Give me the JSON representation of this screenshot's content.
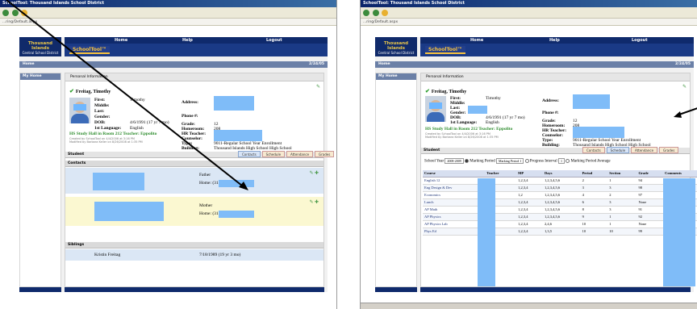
{
  "left": {
    "title_bar": "SchoolTool: Thousand Islands School District",
    "address": "...ring/Default.aspx",
    "logo": {
      "line1": "Thousand Islands",
      "line2": "Central School District"
    },
    "nav": {
      "home": "Home",
      "help": "Help",
      "logout": "Logout"
    },
    "brand": "SchoolTool™",
    "home_bar": "Home",
    "date": "2/24/05",
    "sidebar_heading": "My Home",
    "tab": "Personal Information",
    "student_name": "Freitag, Timothy",
    "labels": {
      "first": "First:",
      "middle": "Middle:",
      "last": "Last:",
      "gender": "Gender:",
      "dob": "DOB:",
      "first_language": "1st Language:",
      "address": "Address:",
      "phone": "Phone #:",
      "grade": "Grade:",
      "homeroom": "Homeroom:",
      "hr_teacher": "HR Teacher:",
      "counselor": "Counselor:",
      "type": "Type:",
      "building": "Building:"
    },
    "values": {
      "first": "Timothy",
      "dob": "4/6/1991 (17 yr 7 mo)",
      "first_language": "English",
      "grade": "12",
      "homeroom": "208",
      "type": "9011-Regular School Year Enrollment",
      "building": "Thousand Islands High School High School"
    },
    "study_hall": "HS Study Hall in Room 212 Teacher: Eppolito",
    "created_by": "Created by SchoolTool on 4/4/2006 at 3:16 PM",
    "modified_by": "Modified by Barbara Keller on 8/26/2008 at 1:35 PM",
    "student_tab": "Student",
    "subtabs": [
      "Contacts",
      "Schedule",
      "Attendance",
      "Grades"
    ],
    "contacts_heading": "Contacts",
    "contacts": [
      {
        "relation": "Father",
        "home_label": "Home: (315"
      },
      {
        "relation": "Mother",
        "home_label": "Home: (315"
      }
    ],
    "siblings_heading": "Siblings",
    "sibling": {
      "name": "Kristin Freitag",
      "dob": "7/18/1989 (19 yr 3 mo)"
    }
  },
  "right": {
    "title_bar": "SchoolTool: Thousand Islands School District",
    "address": "...ring/Default.aspx",
    "logo": {
      "line1": "Thousand Islands",
      "line2": "Central School District"
    },
    "nav": {
      "home": "Home",
      "help": "Help",
      "logout": "Logout"
    },
    "brand": "SchoolTool™",
    "home_bar": "Home",
    "date": "2/24/05",
    "sidebar_heading": "My Home",
    "tab": "Personal Information",
    "student_name": "Freitag, Timothy",
    "values": {
      "first": "Timothy",
      "dob": "4/6/1991 (17 yr 7 mo)",
      "first_language": "English",
      "grade": "12",
      "homeroom": "208",
      "type": "9011-Regular School Year Enrollment",
      "building": "Thousand Islands High School High School"
    },
    "study_hall": "HS Study Hall in Room 212 Teacher: Eppolito",
    "created_by": "Created by SchoolTool on 4/4/2006 at 3:16 PM",
    "modified_by": "Modified by Barbara Keller on 8/26/2008 at 1:35 PM",
    "student_tab": "Student",
    "subtabs": [
      "Contacts",
      "Schedule",
      "Attendance",
      "Grades"
    ],
    "filters": {
      "school_year_label": "School Year",
      "school_year_value": "2008-2009",
      "marking_period_label": "Marking Period",
      "marking_period_value": "Marking Period 1",
      "progress_interval_label": "Progress Interval",
      "progress_interval_value": "1",
      "mp_average_label": "Marking Period Average"
    },
    "grades_columns": [
      "Course",
      "Teacher",
      "MP",
      "Days",
      "Period",
      "Section",
      "Grade",
      "Comments"
    ],
    "grades_rows": [
      {
        "course": "English 12",
        "mp": "1,2,3,4",
        "days": "1,2,3,4,5,6",
        "period": "2",
        "section": "1",
        "grade": "94"
      },
      {
        "course": "Eng Design & Dev",
        "mp": "1,2,3,4",
        "days": "1,2,3,4,5,6",
        "period": "3",
        "section": "3",
        "grade": "98"
      },
      {
        "course": "Economics",
        "mp": "1,2",
        "days": "1,2,3,4,5,6",
        "period": "4",
        "section": "2",
        "grade": "97"
      },
      {
        "course": "Lunch",
        "mp": "1,2,3,4",
        "days": "1,2,3,4,5,6",
        "period": "6",
        "section": "3",
        "grade": "None"
      },
      {
        "course": "AP Math",
        "mp": "1,2,3,4",
        "days": "1,2,3,4,5,6",
        "period": "8",
        "section": "3",
        "grade": "91"
      },
      {
        "course": "AP Physics",
        "mp": "1,2,3,4",
        "days": "1,2,3,4,5,6",
        "period": "9",
        "section": "1",
        "grade": "92"
      },
      {
        "course": "AP Physics Lab",
        "mp": "1,2,3,4",
        "days": "2,4,6",
        "period": "10",
        "section": "1",
        "grade": "None"
      },
      {
        "course": "Phys Ed",
        "mp": "1,2,3,4",
        "days": "1,3,5",
        "period": "10",
        "section": "10",
        "grade": "99"
      }
    ]
  }
}
